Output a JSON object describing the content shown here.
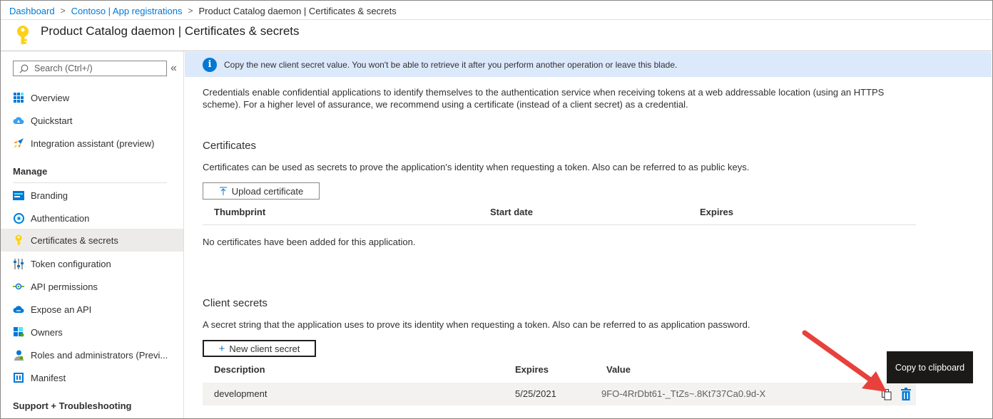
{
  "breadcrumb": {
    "items": [
      "Dashboard",
      "Contoso | App registrations",
      "Product Catalog daemon | Certificates & secrets"
    ],
    "separator": ">"
  },
  "header": {
    "title": "Product Catalog daemon | Certificates & secrets",
    "icon": "key-icon"
  },
  "sidebar": {
    "search_placeholder": "Search (Ctrl+/)",
    "collapse_label": "«",
    "items_top": [
      {
        "label": "Overview",
        "icon": "overview-grid-icon"
      },
      {
        "label": "Quickstart",
        "icon": "quickstart-cloud-icon"
      },
      {
        "label": "Integration assistant (preview)",
        "icon": "rocket-icon"
      }
    ],
    "manage_title": "Manage",
    "items_manage": [
      {
        "label": "Branding",
        "icon": "branding-icon"
      },
      {
        "label": "Authentication",
        "icon": "authentication-icon"
      },
      {
        "label": "Certificates & secrets",
        "icon": "key-icon",
        "active": true
      },
      {
        "label": "Token configuration",
        "icon": "token-config-icon"
      },
      {
        "label": "API permissions",
        "icon": "api-permissions-icon"
      },
      {
        "label": "Expose an API",
        "icon": "expose-api-cloud-icon"
      },
      {
        "label": "Owners",
        "icon": "owners-icon"
      },
      {
        "label": "Roles and administrators (Previ...",
        "icon": "roles-icon"
      },
      {
        "label": "Manifest",
        "icon": "manifest-icon"
      }
    ],
    "support_title": "Support + Troubleshooting"
  },
  "main": {
    "info_banner": "Copy the new client secret value. You won't be able to retrieve it after you perform another operation or leave this blade.",
    "intro_line1": "Credentials enable confidential applications to identify themselves to the authentication service when receiving tokens at a web addressable location (using an HTTPS",
    "intro_line2": "scheme). For a higher level of assurance, we recommend using a certificate (instead of a client secret) as a credential.",
    "certificates": {
      "title": "Certificates",
      "description": "Certificates can be used as secrets to prove the application's identity when requesting a token. Also can be referred to as public keys.",
      "upload_button": "Upload certificate",
      "columns": [
        "Thumbprint",
        "Start date",
        "Expires"
      ],
      "empty_message": "No certificates have been added for this application."
    },
    "client_secrets": {
      "title": "Client secrets",
      "description": "A secret string that the application uses to prove its identity when requesting a token. Also can be referred to as application password.",
      "new_button": "New client secret",
      "columns": [
        "Description",
        "Expires",
        "Value"
      ],
      "rows": [
        {
          "description": "development",
          "expires": "5/25/2021",
          "value": "9FO-4RrDbt61-_TtZs~.8Kt737Ca0.9d-X"
        }
      ]
    },
    "tooltip": "Copy to clipboard"
  },
  "colors": {
    "accent": "#0078d4",
    "banner": "#dbe9fb",
    "annotation_arrow": "#e8413b",
    "key": "#fcd116"
  }
}
